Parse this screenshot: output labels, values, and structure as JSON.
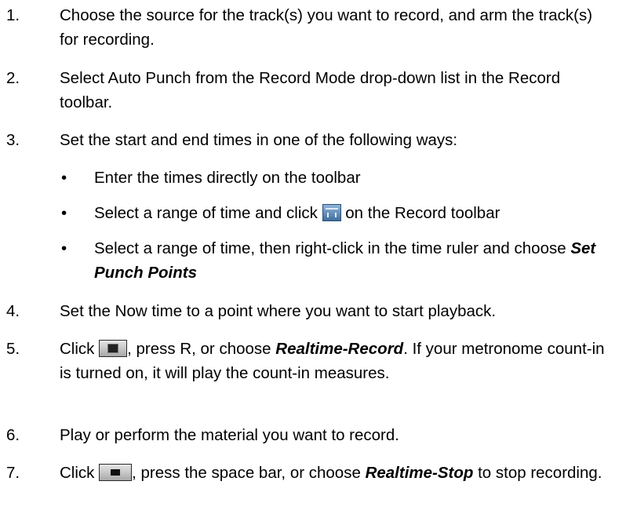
{
  "steps": [
    {
      "num": "1.",
      "text": "Choose the source for the track(s) you want to record, and arm the track(s) for recording."
    },
    {
      "num": "2.",
      "text": "Select Auto Punch from the Record Mode drop-down list in the Record toolbar."
    },
    {
      "num": "3.",
      "text": "Set the start and end times in one of the following ways:"
    },
    {
      "num": "4.",
      "text": "Set the Now time to a point where you want to start playback."
    },
    {
      "num": "5.",
      "pre": "Click",
      "mid": ", press R, or choose",
      "cmd": "Realtime-Record",
      "post": ". If your metronome count-in is turned on, it will play the count-in measures."
    },
    {
      "num": "6.",
      "text": "Play or perform the material you want to record."
    },
    {
      "num": "7.",
      "pre": "Click",
      "mid": ", press the space bar, or choose",
      "cmd": "Realtime-Stop",
      "post": "to stop recording."
    }
  ],
  "bullets": [
    {
      "dot": "•",
      "text": "Enter the times directly on the toolbar"
    },
    {
      "dot": "•",
      "pre": "Select a range of time and click",
      "post": "on the Record toolbar"
    },
    {
      "dot": "•",
      "pre": "Select a range of time, then right-click in the time ruler and choose",
      "cmd": "Set Punch Points"
    }
  ],
  "icons": {
    "punch": "set-punch-points-icon",
    "record": "record-icon",
    "stop": "stop-icon"
  }
}
